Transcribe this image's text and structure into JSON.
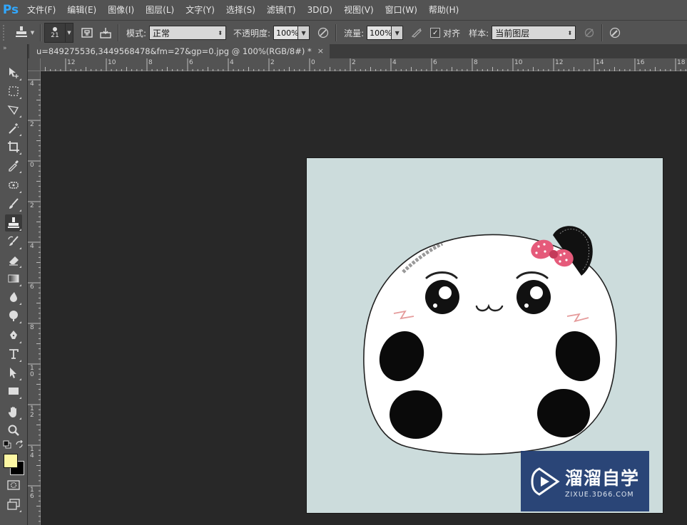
{
  "app": {
    "logo": "Ps"
  },
  "menu": [
    "文件(F)",
    "编辑(E)",
    "图像(I)",
    "图层(L)",
    "文字(Y)",
    "选择(S)",
    "滤镜(T)",
    "3D(D)",
    "视图(V)",
    "窗口(W)",
    "帮助(H)"
  ],
  "options": {
    "brush_size": "21",
    "mode_label": "模式:",
    "mode_value": "正常",
    "opacity_label": "不透明度:",
    "opacity_value": "100%",
    "flow_label": "流量:",
    "flow_value": "100%",
    "align_label": "对齐",
    "align_checked": true,
    "sample_label": "样本:",
    "sample_value": "当前图层"
  },
  "document": {
    "tab_title": "u=849275536,3449568478&fm=27&gp=0.jpg @ 100%(RGB/8#) *",
    "close": "×",
    "background": "#ccdcdc"
  },
  "rulers": {
    "h_labels": [
      "12",
      "10",
      "8",
      "6",
      "4",
      "2",
      "0",
      "2",
      "4",
      "6",
      "8",
      "10",
      "12",
      "14",
      "16",
      "18"
    ],
    "v_labels": [
      "4",
      "2",
      "0",
      "2",
      "4",
      "6",
      "8",
      "1 0",
      "1 2",
      "1 4",
      "1 6"
    ]
  },
  "toolbar": {
    "tools": [
      "move-tool",
      "marquee-tool",
      "lasso-tool",
      "magic-wand-tool",
      "crop-tool",
      "eyedropper-tool",
      "healing-brush-tool",
      "brush-tool",
      "clone-stamp-tool",
      "history-brush-tool",
      "eraser-tool",
      "gradient-tool",
      "blur-tool",
      "dodge-tool",
      "pen-tool",
      "type-tool",
      "path-selection-tool",
      "rectangle-tool",
      "hand-tool",
      "zoom-tool"
    ],
    "active_tool": "clone-stamp-tool",
    "foreground_color": "#fdf7a3",
    "background_color": "#000000"
  },
  "watermark": {
    "title": "溜溜自学",
    "url": "ZIXUE.3D66.COM"
  }
}
